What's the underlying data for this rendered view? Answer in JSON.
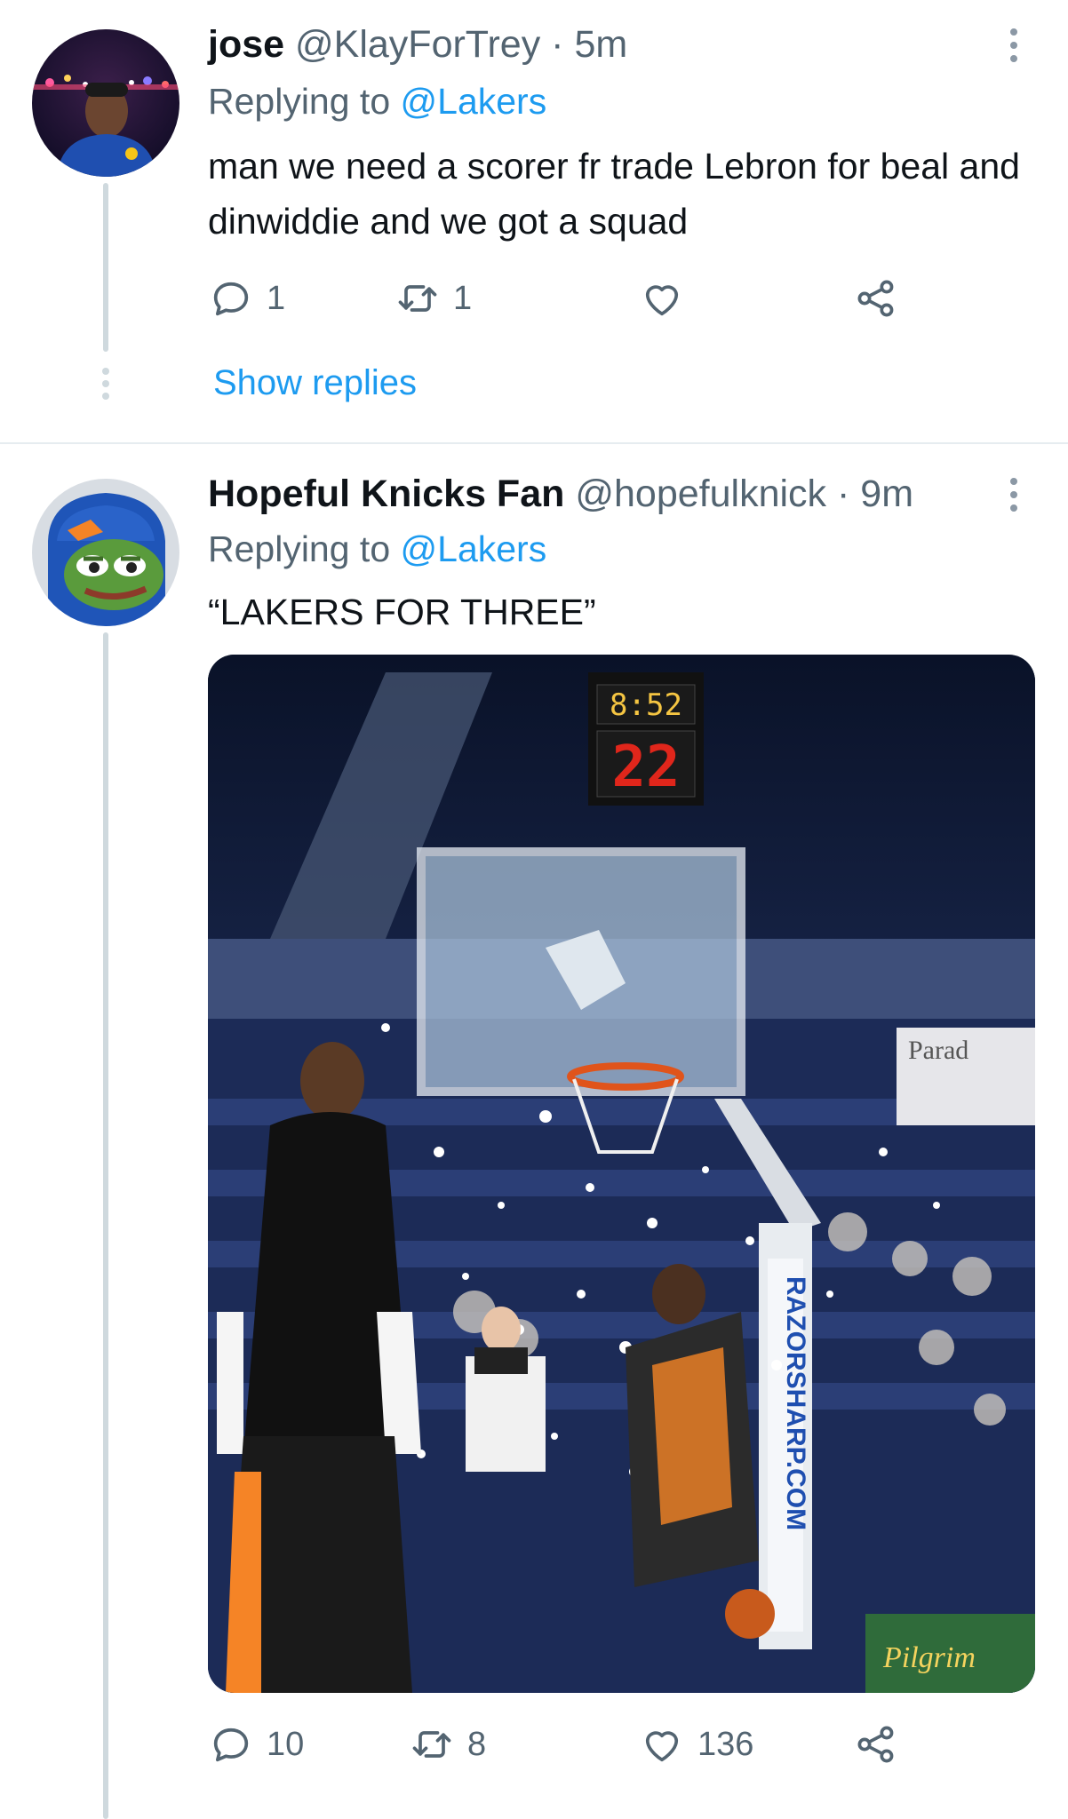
{
  "tweets": [
    {
      "display_name": "jose",
      "handle": "@KlayForTrey",
      "separator": "·",
      "time": "5m",
      "replying_prefix": "Replying to",
      "replying_to": "@Lakers",
      "text": "man we need a scorer fr trade Lebron for beal and dinwiddie and we got a squad",
      "replies": "1",
      "retweets": "1",
      "likes": "",
      "show_replies": "Show replies"
    },
    {
      "display_name": "Hopeful Knicks Fan",
      "handle": "@hopefulknick",
      "separator": "·",
      "time": "9m",
      "replying_prefix": "Replying to",
      "replying_to": "@Lakers",
      "text": "“LAKERS FOR THREE”",
      "replies": "10",
      "retweets": "8",
      "likes": "136",
      "media": {
        "scoreboard_clock": "8:52",
        "shot_clock": "22",
        "stanchion_text": "RAZORSHARP.COM",
        "banner_text": "Parad",
        "sign_text": "Pilgrim"
      }
    }
  ],
  "icons": {
    "reply": "reply-icon",
    "retweet": "retweet-icon",
    "like": "heart-icon",
    "share": "share-icon",
    "more": "more-vertical-icon"
  },
  "colors": {
    "link": "#1d9bf0",
    "muted": "#536471",
    "thread_line": "#cfd9de"
  }
}
